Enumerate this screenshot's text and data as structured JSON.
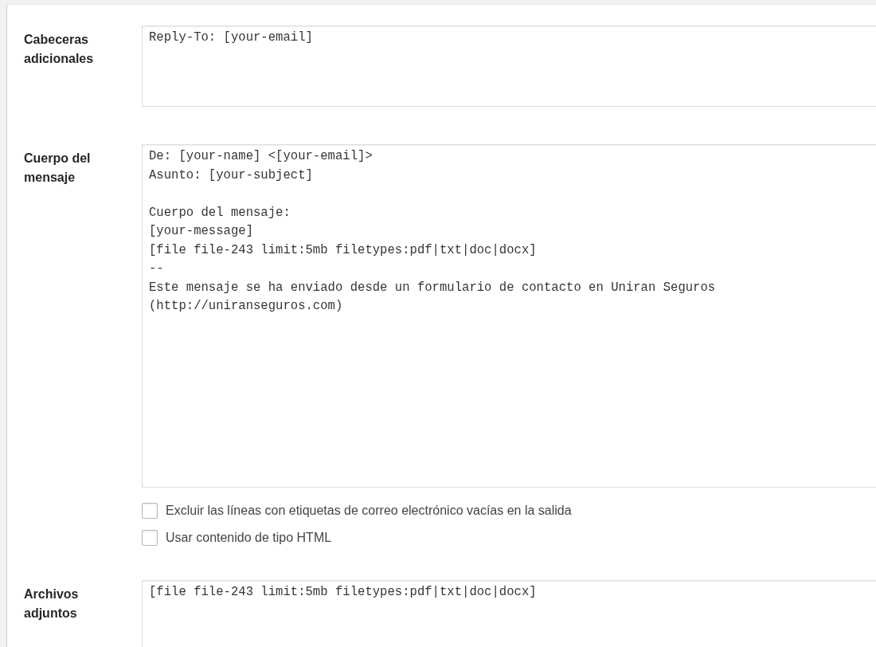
{
  "fields": [
    {
      "kind": "textarea",
      "label": "Cabeceras adicionales",
      "value": "Reply-To: [your-email]"
    },
    {
      "kind": "textarea",
      "label": "Cuerpo del mensaje",
      "value": "De: [your-name] <[your-email]>\nAsunto: [your-subject]\n\nCuerpo del mensaje:\n[your-message]\n[file file-243 limit:5mb filetypes:pdf|txt|doc|docx]\n--\nEste mensaje se ha enviado desde un formulario de contacto en Uniran Seguros\n(http://uniranseguros.com)",
      "options": [
        {
          "label": "Excluir las líneas con etiquetas de correo electrónico vacías en la salida",
          "checked": false
        },
        {
          "label": "Usar contenido de tipo HTML",
          "checked": false
        }
      ]
    },
    {
      "kind": "textarea",
      "label": "Archivos adjuntos",
      "value": "[file file-243 limit:5mb filetypes:pdf|txt|doc|docx]"
    }
  ]
}
